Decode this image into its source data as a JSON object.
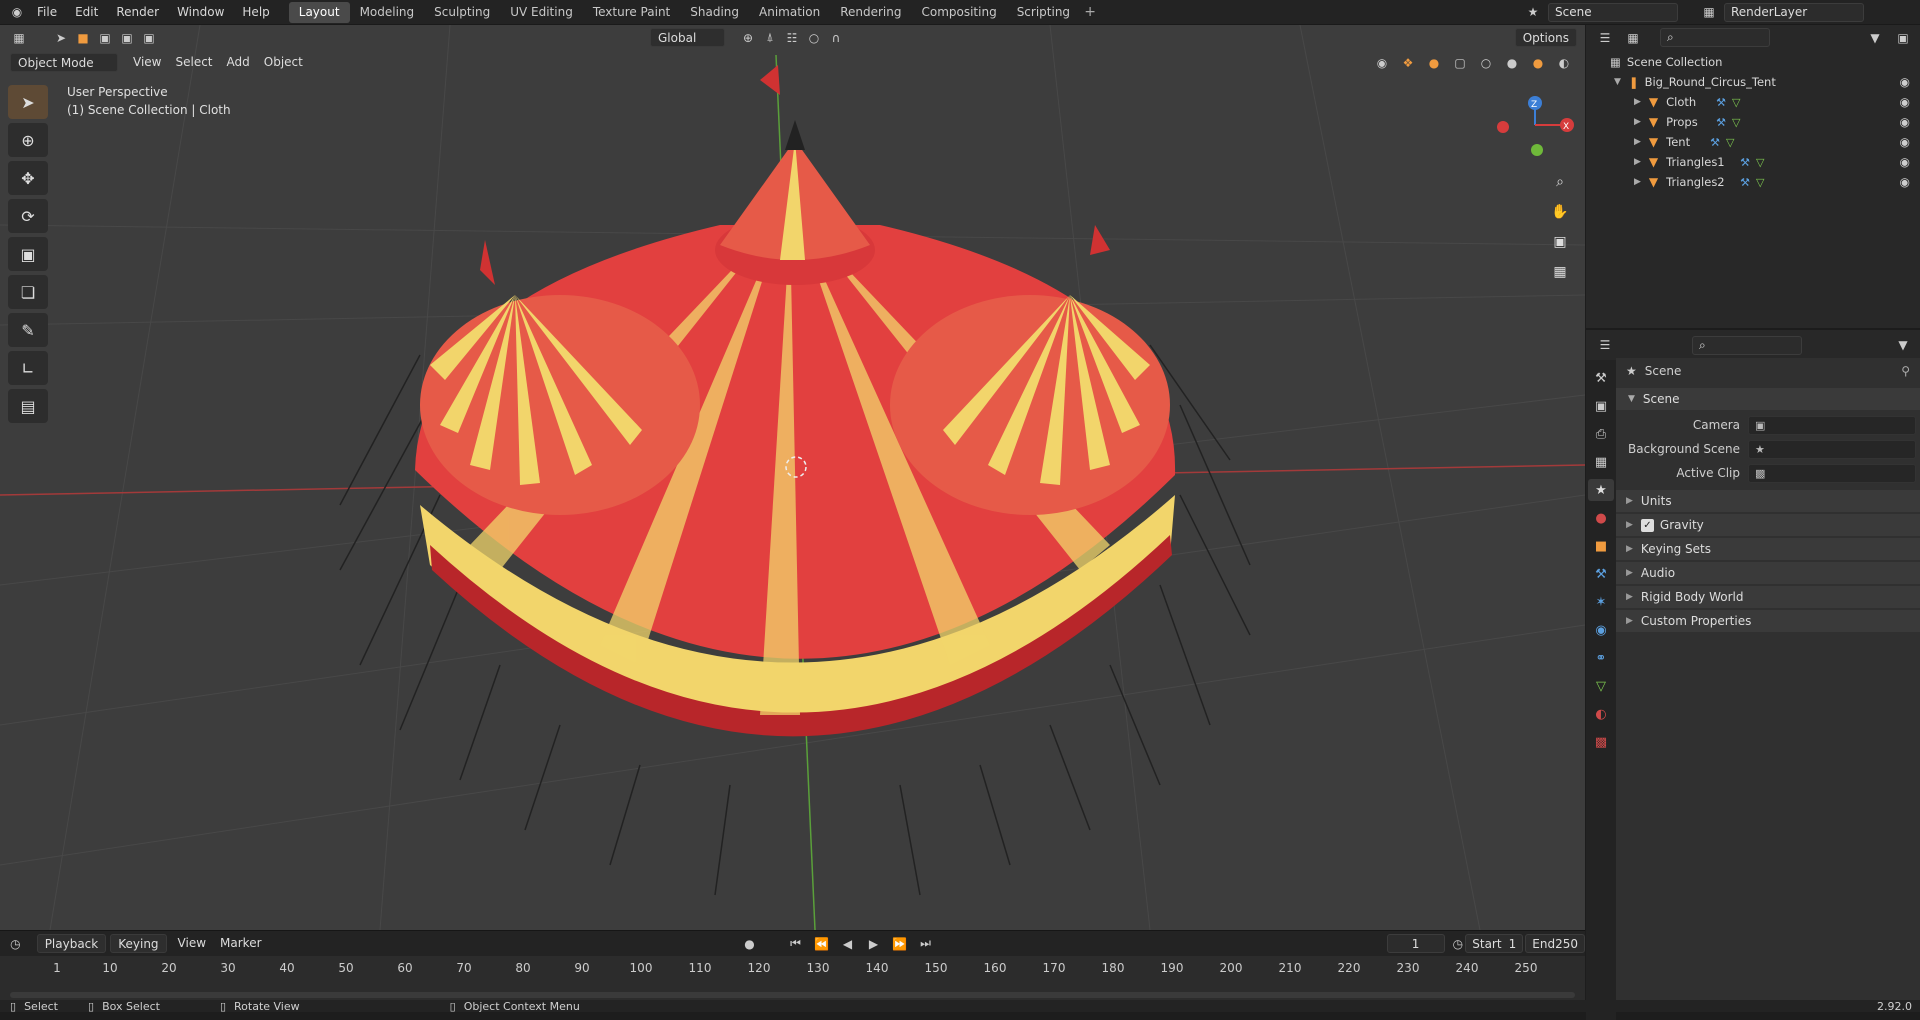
{
  "topbar": {
    "menu": [
      "File",
      "Edit",
      "Render",
      "Window",
      "Help"
    ],
    "workspaces": [
      "Layout",
      "Modeling",
      "Sculpting",
      "UV Editing",
      "Texture Paint",
      "Shading",
      "Animation",
      "Rendering",
      "Compositing",
      "Scripting"
    ],
    "active_workspace": "Layout",
    "scene_name": "Scene",
    "view_layer": "RenderLayer"
  },
  "viewport": {
    "mode": "Object Mode",
    "menus": [
      "View",
      "Select",
      "Add",
      "Object"
    ],
    "transform_orientation": "Global",
    "options_label": "Options",
    "perspective": "User Perspective",
    "collection_info": "(1) Scene Collection | Cloth",
    "gizmo": {
      "z": "Z",
      "x": "X"
    }
  },
  "outliner": {
    "root": "Scene Collection",
    "collection": "Big_Round_Circus_Tent",
    "items": [
      "Cloth",
      "Props",
      "Tent",
      "Triangles1",
      "Triangles2"
    ]
  },
  "properties": {
    "header": "Scene",
    "panel": "Scene",
    "fields": [
      {
        "label": "Camera",
        "value": ""
      },
      {
        "label": "Background Scene",
        "value": ""
      },
      {
        "label": "Active Clip",
        "value": ""
      }
    ],
    "subpanels": [
      "Units",
      "Gravity",
      "Keying Sets",
      "Audio",
      "Rigid Body World",
      "Custom Properties"
    ],
    "gravity_checked": true
  },
  "timeline": {
    "menus": [
      "Playback",
      "Keying",
      "View",
      "Marker"
    ],
    "current_frame": "1",
    "start_label": "Start",
    "start": "1",
    "end_label": "End",
    "end": "250",
    "ticks": [
      "1",
      "10",
      "20",
      "30",
      "40",
      "50",
      "60",
      "70",
      "80",
      "90",
      "100",
      "110",
      "120",
      "130",
      "140",
      "150",
      "160",
      "170",
      "180",
      "190",
      "200",
      "210",
      "220",
      "230",
      "240",
      "250"
    ]
  },
  "statusbar": {
    "select": "Select",
    "box_select": "Box Select",
    "rotate": "Rotate View",
    "context": "Object Context Menu",
    "version": "2.92.0"
  },
  "colors": {
    "tent_red": "#e2403f",
    "tent_yellow": "#f2d56b",
    "accent_orange": "#f09b3f",
    "axis_red": "#d63c3c",
    "axis_green": "#6fb93a",
    "axis_blue": "#3c7fd6"
  }
}
